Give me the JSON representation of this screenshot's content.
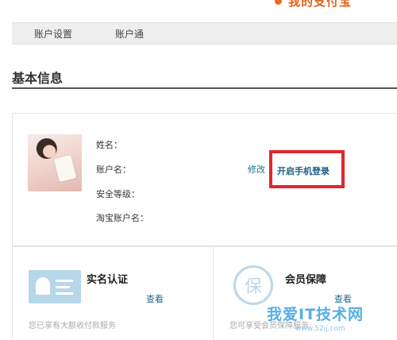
{
  "header": {
    "brand_title": "我的支付宝"
  },
  "tabs": [
    {
      "label": "账户设置"
    },
    {
      "label": "账户通"
    }
  ],
  "section": {
    "title": "基本信息"
  },
  "profile": {
    "name_label": "姓名：",
    "account_label": "账户名：",
    "security_label": "安全等级：",
    "taobao_label": "淘宝账户名：",
    "edit_link": "修改",
    "mobile_login_link": "开启手机登录"
  },
  "cards": [
    {
      "title": "实名认证",
      "link": "查看",
      "desc": "您已享有大额收付款服务"
    },
    {
      "title": "会员保障",
      "link": "查看",
      "desc": "您可享受会员保障服务"
    }
  ],
  "watermark": {
    "text": "我爱IT技术网",
    "sub": "www.52ij.com"
  },
  "colors": {
    "accent_orange": "#e25f17",
    "highlight_red": "#e0282e",
    "link_blue": "#1e6c8f"
  }
}
